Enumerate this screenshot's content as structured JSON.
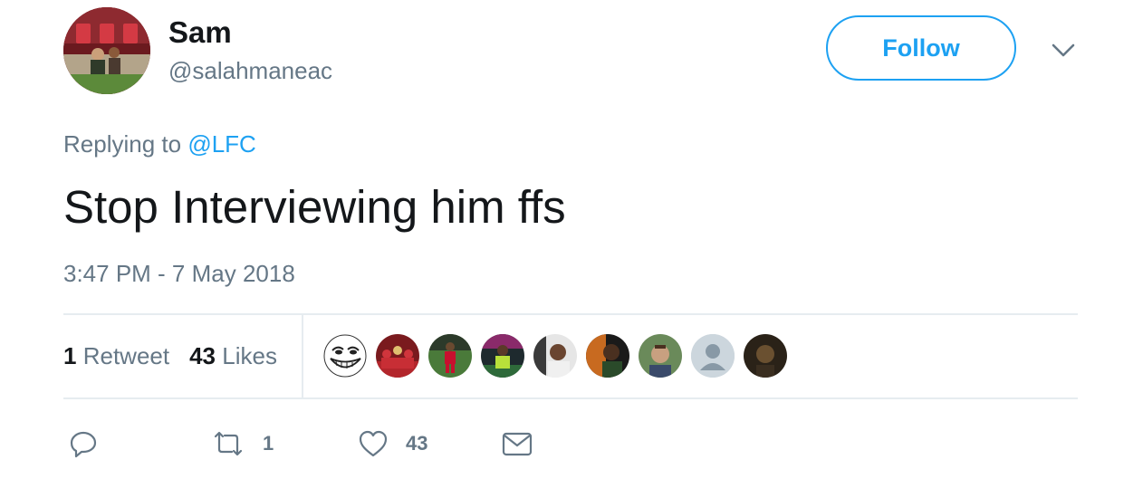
{
  "user": {
    "name": "Sam",
    "handle": "@salahmaneac"
  },
  "follow_label": "Follow",
  "reply_context": {
    "prefix": "Replying to",
    "mention": "@LFC"
  },
  "tweet_text": "Stop Interviewing him ffs",
  "timestamp": "3:47 PM - 7 May 2018",
  "stats": {
    "retweets_count": "1",
    "retweets_label": "Retweet",
    "likes_count": "43",
    "likes_label": "Likes"
  },
  "liked_by_avatars": [
    "troll-face-avatar",
    "team-celebration-avatar",
    "player-on-pitch-avatar",
    "stadium-player-avatar",
    "person-portrait-avatar",
    "dark-portrait-avatar",
    "man-portrait-avatar",
    "default-profile-avatar",
    "dim-portrait-avatar"
  ],
  "actions": {
    "reply_icon": "reply-icon",
    "retweet_icon": "retweet-icon",
    "retweet_count": "1",
    "like_icon": "heart-icon",
    "like_count": "43",
    "dm_icon": "envelope-icon"
  },
  "colors": {
    "accent": "#1da1f2",
    "text": "#14171a",
    "muted": "#657786",
    "divider": "#e6ecf0"
  }
}
